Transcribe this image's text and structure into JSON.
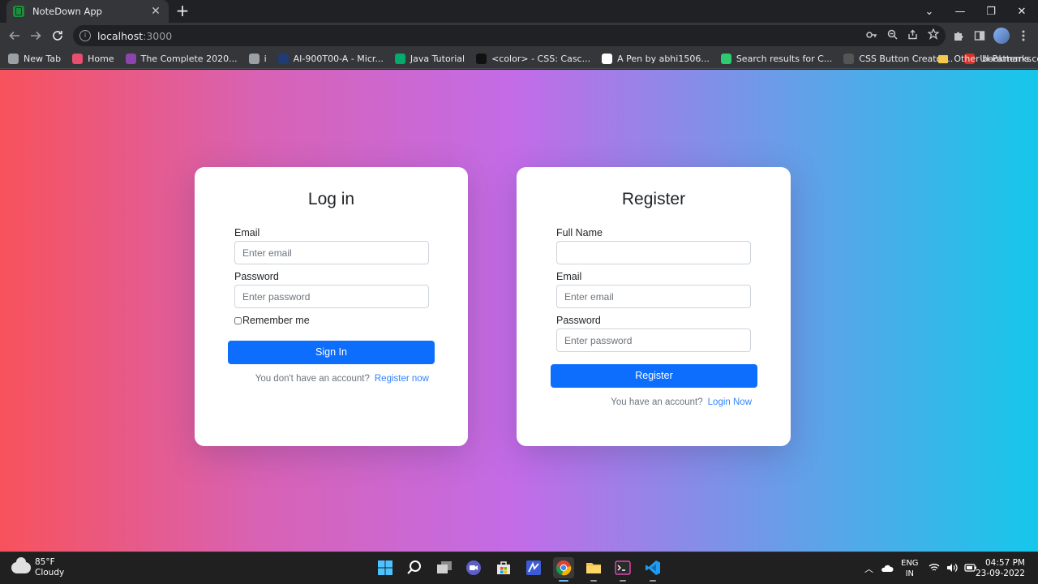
{
  "browser": {
    "tab": {
      "title": "NoteDown App",
      "close": "✕"
    },
    "new_tab": "+",
    "window_controls": {
      "chevron": "⌄",
      "minimize": "—",
      "maximize": "❐",
      "close": "✕"
    },
    "url": {
      "host": "localhost",
      "port": ":3000"
    },
    "bookmarks": [
      {
        "label": "New Tab",
        "color": "#9aa0a6"
      },
      {
        "label": "Home",
        "color": "#e94e6c"
      },
      {
        "label": "The Complete 2020...",
        "color": "#8e44ad"
      },
      {
        "label": "i",
        "color": "#9aa0a6"
      },
      {
        "label": "AI-900T00-A - Micr...",
        "color": "#1f3c73"
      },
      {
        "label": "Java Tutorial",
        "color": "#04aa6d"
      },
      {
        "label": "<color> - CSS: Casc...",
        "color": "#111111"
      },
      {
        "label": "A Pen by abhi1506...",
        "color": "#ffffff"
      },
      {
        "label": "Search results for C...",
        "color": "#2ecc71"
      },
      {
        "label": "CSS Button Creator...",
        "color": "#555555"
      },
      {
        "label": "UI-Patterns.com",
        "color": "#d9342b"
      }
    ],
    "bookmarks_more": "»",
    "other_bookmarks": "Other bookmarks"
  },
  "login": {
    "title": "Log in",
    "email_label": "Email",
    "email_placeholder": "Enter email",
    "password_label": "Password",
    "password_placeholder": "Enter password",
    "remember_label": "Remember me",
    "submit": "Sign In",
    "switch_text": "You don't have an account?",
    "switch_link": "Register now"
  },
  "register": {
    "title": "Register",
    "name_label": "Full Name",
    "name_placeholder": "",
    "email_label": "Email",
    "email_placeholder": "Enter email",
    "password_label": "Password",
    "password_placeholder": "Enter password",
    "submit": "Register",
    "switch_text": "You have an account?",
    "switch_link": "Login Now"
  },
  "taskbar": {
    "weather": {
      "temp": "85°F",
      "condition": "Cloudy"
    },
    "language": {
      "line1": "ENG",
      "line2": "IN"
    },
    "clock": {
      "time": "04:57 PM",
      "date": "23-09-2022"
    },
    "tray_chevron": "︿"
  }
}
